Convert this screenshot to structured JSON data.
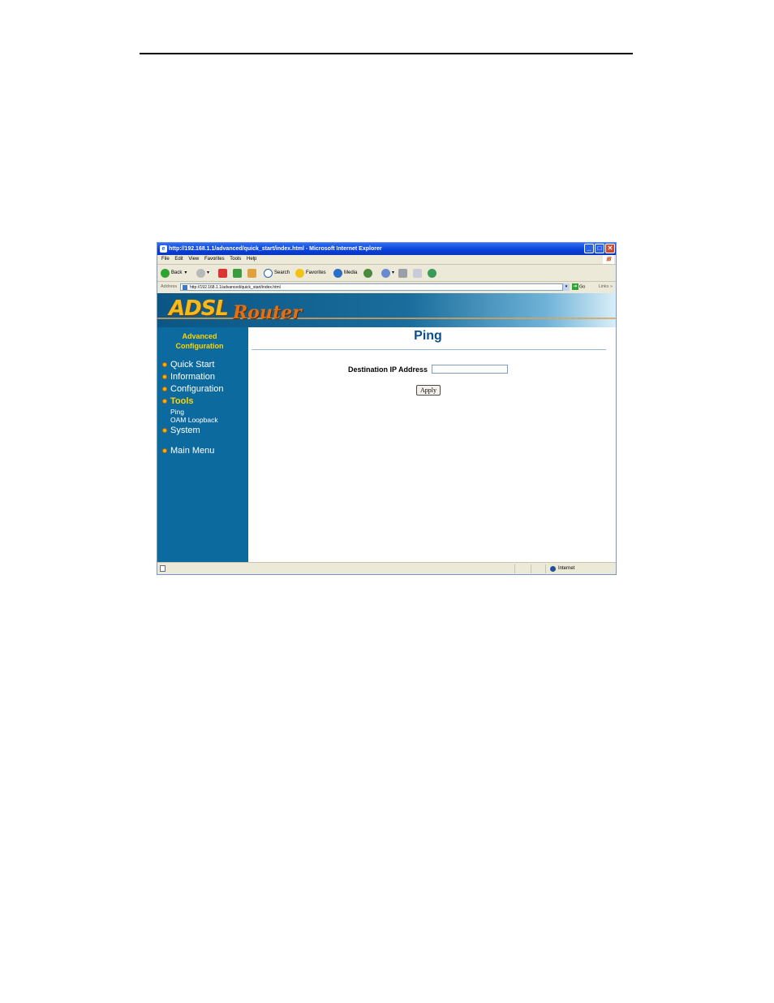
{
  "window": {
    "title": "http://192.168.1.1/advanced/quick_start/index.html - Microsoft Internet Explorer",
    "min_glyph": "_",
    "max_glyph": "□",
    "close_glyph": "✕"
  },
  "menubar": {
    "items": [
      "File",
      "Edit",
      "View",
      "Favorites",
      "Tools",
      "Help"
    ]
  },
  "toolbar": {
    "back": "Back",
    "search": "Search",
    "favorites": "Favorites",
    "media": "Media"
  },
  "addressbar": {
    "label": "Address",
    "url": "http://192.168.1.1/advanced/quick_start/index.html",
    "go": "Go",
    "links": "Links",
    "more": "»"
  },
  "banner": {
    "logo_main": "ADSL",
    "logo_sub": "Router"
  },
  "sidebar": {
    "heading_line1": "Advanced",
    "heading_line2": "Configuration",
    "items": [
      "Quick Start",
      "Information",
      "Configuration",
      "Tools",
      "System",
      "Main Menu"
    ],
    "active": "Tools",
    "subitems": [
      "Ping",
      "OAM Loopback"
    ]
  },
  "main": {
    "title": "Ping",
    "dest_label": "Destination IP Address",
    "dest_value": "",
    "apply_label": "Apply"
  },
  "statusbar": {
    "zone": "Internet"
  },
  "colors": {
    "sidebar_bg": "#0d6a9e",
    "heading_yellow": "#ffd400",
    "title_blue": "#0b4f8f",
    "logo_orange": "#f8b91b"
  }
}
